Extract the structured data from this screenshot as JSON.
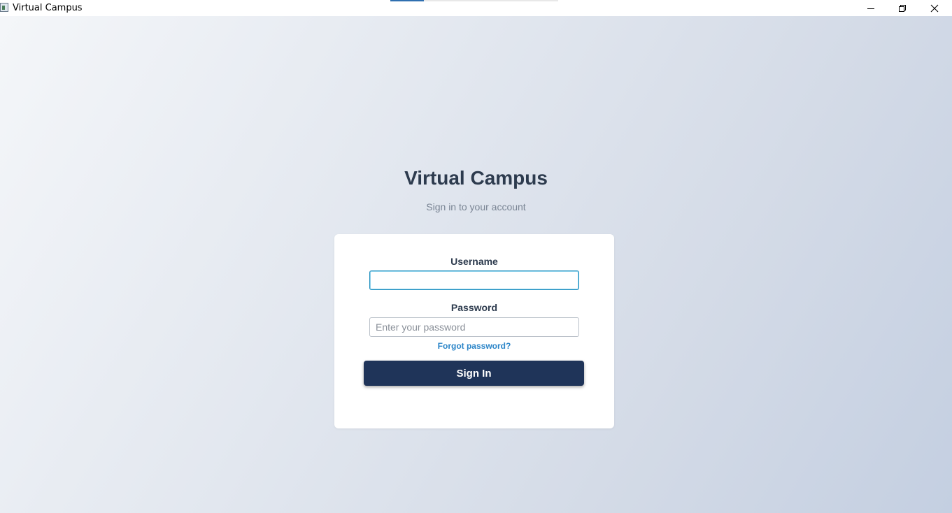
{
  "window": {
    "title": "Virtual Campus",
    "controls": [
      "minimize-icon",
      "maximize-icon",
      "close-icon"
    ]
  },
  "login": {
    "heading": "Virtual Campus",
    "subheading": "Sign in to your account",
    "username_label": "Username",
    "username_value": "",
    "password_label": "Password",
    "password_placeholder": "Enter your password",
    "forgot_link": "Forgot password?",
    "signin_button": "Sign In"
  },
  "colors": {
    "primary": "#1f3459",
    "link": "#2b85c8",
    "heading": "#2d3b4e",
    "focus": "#1f8fbf"
  }
}
